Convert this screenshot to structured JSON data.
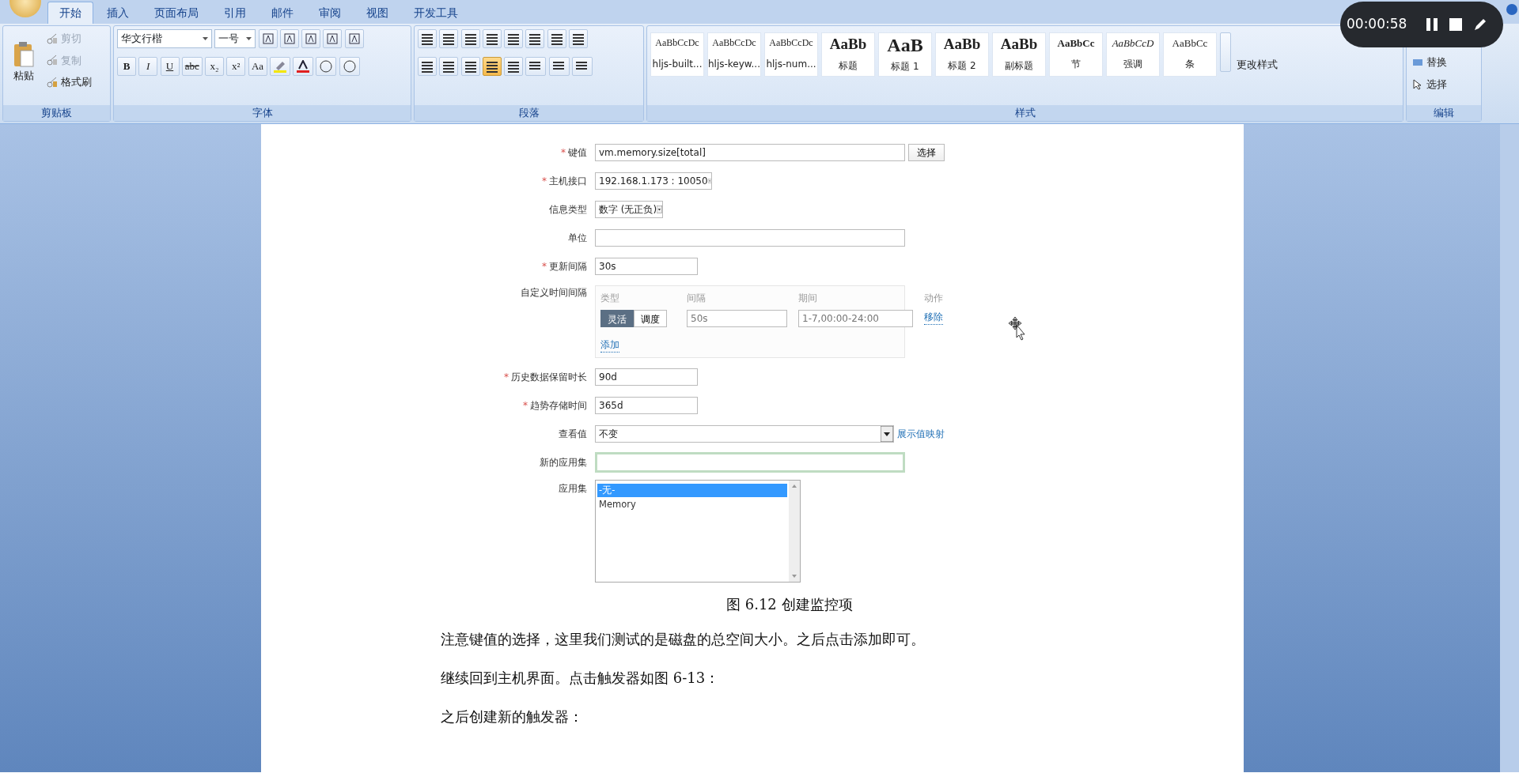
{
  "ribbon": {
    "tabs": [
      {
        "label": "开始",
        "selected": true
      },
      {
        "label": "插入",
        "selected": false
      },
      {
        "label": "页面布局",
        "selected": false
      },
      {
        "label": "引用",
        "selected": false
      },
      {
        "label": "邮件",
        "selected": false
      },
      {
        "label": "审阅",
        "selected": false
      },
      {
        "label": "视图",
        "selected": false
      },
      {
        "label": "开发工具",
        "selected": false
      }
    ],
    "clipboard": {
      "paste": "粘贴",
      "items": [
        {
          "label": "剪切",
          "disabled": true
        },
        {
          "label": "复制",
          "disabled": true
        },
        {
          "label": "格式刷",
          "disabled": false
        }
      ],
      "group_label": "剪贴板"
    },
    "font": {
      "font_name": "华文行楷",
      "font_size": "一号",
      "format_buttons": [
        "B",
        "I",
        "U",
        "abc",
        "x₂",
        "x²",
        "Aa"
      ],
      "group_label": "字体"
    },
    "paragraph": {
      "alignments": [
        {
          "selected": false
        },
        {
          "selected": false
        },
        {
          "selected": false
        },
        {
          "selected": true
        },
        {
          "selected": false
        }
      ],
      "group_label": "段落"
    },
    "styles": {
      "gallery": [
        {
          "preview": "AaBbCcDc",
          "name": "hljs-built..."
        },
        {
          "preview": "AaBbCcDc",
          "name": "hljs-keyw..."
        },
        {
          "preview": "AaBbCcDc",
          "name": "hljs-num..."
        },
        {
          "preview": "AaBb",
          "name": "标题"
        },
        {
          "preview": "AaB",
          "name": "标题 1"
        },
        {
          "preview": "AaBb",
          "name": "标题 2"
        },
        {
          "preview": "AaBb",
          "name": "副标题"
        },
        {
          "preview": "AaBbCc",
          "name": "节"
        },
        {
          "preview": "AaBbCcD",
          "name": "强调"
        },
        {
          "preview": "AaBbCc",
          "name": "条"
        }
      ],
      "change_styles": "更改样式",
      "group_label": "样式"
    },
    "editing": {
      "items": [
        "替换",
        "选择"
      ],
      "group_label": "编辑"
    }
  },
  "recorder": {
    "time": "00:00:58"
  },
  "document": {
    "form": {
      "rows": [
        {
          "kind": "input",
          "label": "键值",
          "marker": "*",
          "value": "vm.memory.size[total]",
          "button": "选择"
        },
        {
          "kind": "select",
          "label": "主机接口",
          "marker": "*",
          "value": "192.168.1.173 : 10050"
        },
        {
          "kind": "select",
          "label": "信息类型",
          "value": "数字 (无正负)"
        },
        {
          "kind": "input",
          "label": "单位"
        },
        {
          "kind": "short",
          "label": "更新间隔",
          "marker": "*",
          "value": "30s"
        },
        {
          "kind": "intervals",
          "label": "自定义时间间隔",
          "headers": [
            "类型",
            "间隔",
            "期间",
            "动作"
          ],
          "types": [
            {
              "label": "灵活",
              "selected": true
            },
            {
              "label": "调度",
              "selected": false
            }
          ],
          "interval_placeholder": "50s",
          "period_placeholder": "1-7,00:00-24:00",
          "remove": "移除",
          "add": "添加"
        },
        {
          "kind": "short",
          "label": "历史数据保留时长",
          "marker": "*",
          "value": "90d"
        },
        {
          "kind": "short",
          "label": "趋势存储时间",
          "marker": "*",
          "value": "365d"
        },
        {
          "kind": "select",
          "label": "查看值",
          "value": "不变",
          "link": "展示值映射"
        },
        {
          "kind": "input",
          "label": "新的应用集",
          "focused": true
        },
        {
          "kind": "listbox",
          "label": "应用集",
          "options": [
            {
              "label": "-无-",
              "selected": true
            },
            {
              "label": "Memory",
              "selected": false
            }
          ]
        }
      ]
    },
    "caption": "图 6.12 创建监控项",
    "paragraphs": [
      "注意键值的选择，这里我们测试的是磁盘的总空间大小。之后点击添加即可。",
      "继续回到主机界面。点击触发器如图 6-13：",
      "之后创建新的触发器："
    ]
  }
}
